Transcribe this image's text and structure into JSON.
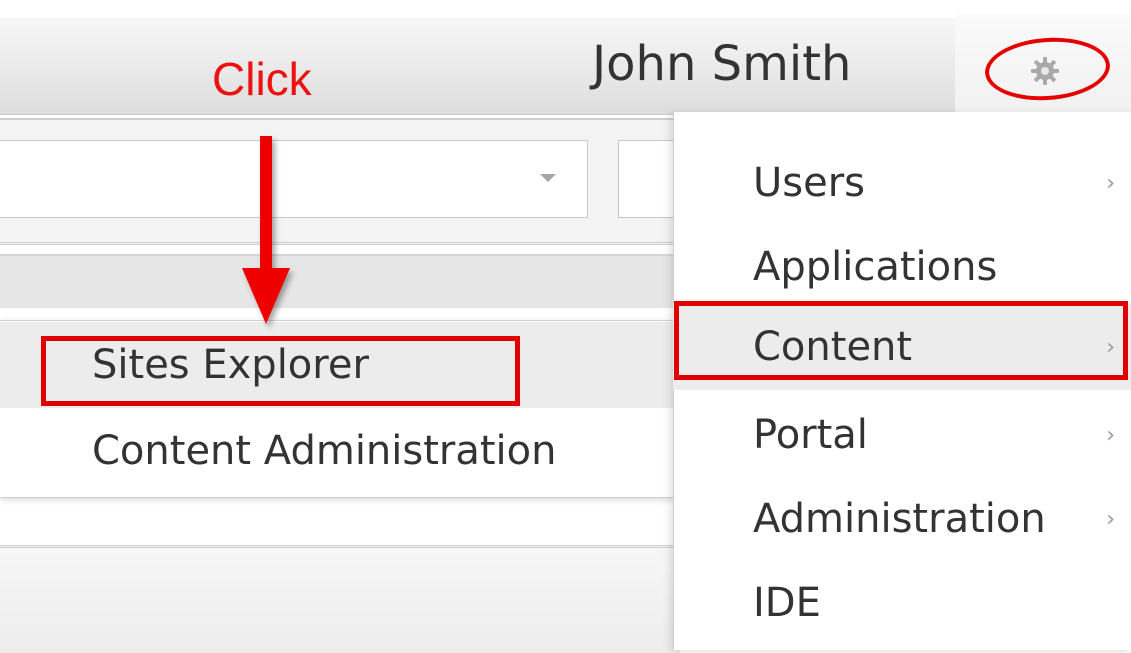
{
  "header": {
    "username": "John Smith",
    "settings_icon": "gear-icon"
  },
  "annotation": {
    "label": "Click",
    "color": "#ee1111"
  },
  "filter": {
    "dropdown_icon": "caret-down-icon"
  },
  "submenu": {
    "items": [
      {
        "label": "Sites Explorer",
        "highlighted": true
      },
      {
        "label": "Content Administration",
        "highlighted": false
      }
    ]
  },
  "menu": {
    "items": [
      {
        "label": "Users",
        "has_submenu": true
      },
      {
        "label": "Applications",
        "has_submenu": false
      },
      {
        "label": "Content",
        "has_submenu": true,
        "highlighted": true
      },
      {
        "label": "Portal",
        "has_submenu": true
      },
      {
        "label": "Administration",
        "has_submenu": true
      },
      {
        "label": "IDE",
        "has_submenu": false
      }
    ],
    "chevron_glyph": "›"
  },
  "colors": {
    "highlight_red": "#e00000",
    "hover_gray": "#ececec"
  }
}
